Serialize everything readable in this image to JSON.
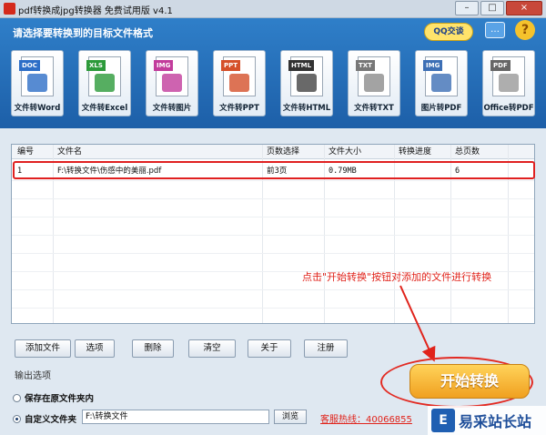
{
  "window": {
    "title": "pdf转换成jpg转换器 免费试用版 v4.1",
    "buttons": [
      "–",
      "□",
      "×"
    ]
  },
  "header": {
    "prompt": "请选择要转换到的目标文件格式",
    "qq_label": "QQ交谈"
  },
  "tools": [
    {
      "tag": "DOC",
      "label": "文件转Word",
      "tag_color": "#2d6ec7",
      "mark_color": "#2d6ec7"
    },
    {
      "tag": "XLS",
      "label": "文件转Excel",
      "tag_color": "#2c9a3a",
      "mark_color": "#2c9a3a"
    },
    {
      "tag": "IMG",
      "label": "文件转图片",
      "tag_color": "#c23c9c",
      "mark_color": "#c23c9c"
    },
    {
      "tag": "PPT",
      "label": "文件转PPT",
      "tag_color": "#d5502a",
      "mark_color": "#d5502a"
    },
    {
      "tag": "HTML",
      "label": "文件转HTML",
      "tag_color": "#333333",
      "mark_color": "#444444"
    },
    {
      "tag": "TXT",
      "label": "文件转TXT",
      "tag_color": "#777777",
      "mark_color": "#8c8c8c"
    },
    {
      "tag": "IMG",
      "label": "图片转PDF",
      "tag_color": "#3d6fb5",
      "mark_color": "#3d6fb5"
    },
    {
      "tag": "PDF",
      "label": "Office转PDF",
      "tag_color": "#666666",
      "mark_color": "#9a9a9a"
    }
  ],
  "table": {
    "headers": [
      "编号",
      "文件名",
      "页数选择",
      "文件大小",
      "转换进度",
      "总页数"
    ],
    "rows": [
      [
        "1",
        "F:\\转换文件\\伤感中的美丽.pdf",
        "前3页",
        "0.79MB",
        "",
        "6"
      ]
    ]
  },
  "annotation": "点击\"开始转换\"按钮对添加的文件进行转换",
  "buttons": [
    "添加文件",
    "选项",
    "删除",
    "清空",
    "关于",
    "注册"
  ],
  "output": {
    "section_label": "输出选项",
    "option_original": "保存在原文件夹内",
    "option_custom": "自定义文件夹",
    "path": "F:\\转换文件",
    "browse": "浏览",
    "selected": "custom"
  },
  "start_label": "开始转换",
  "hotline": "客服热线：40066855",
  "watermark": {
    "logo": "E",
    "text": "易采站长站"
  }
}
